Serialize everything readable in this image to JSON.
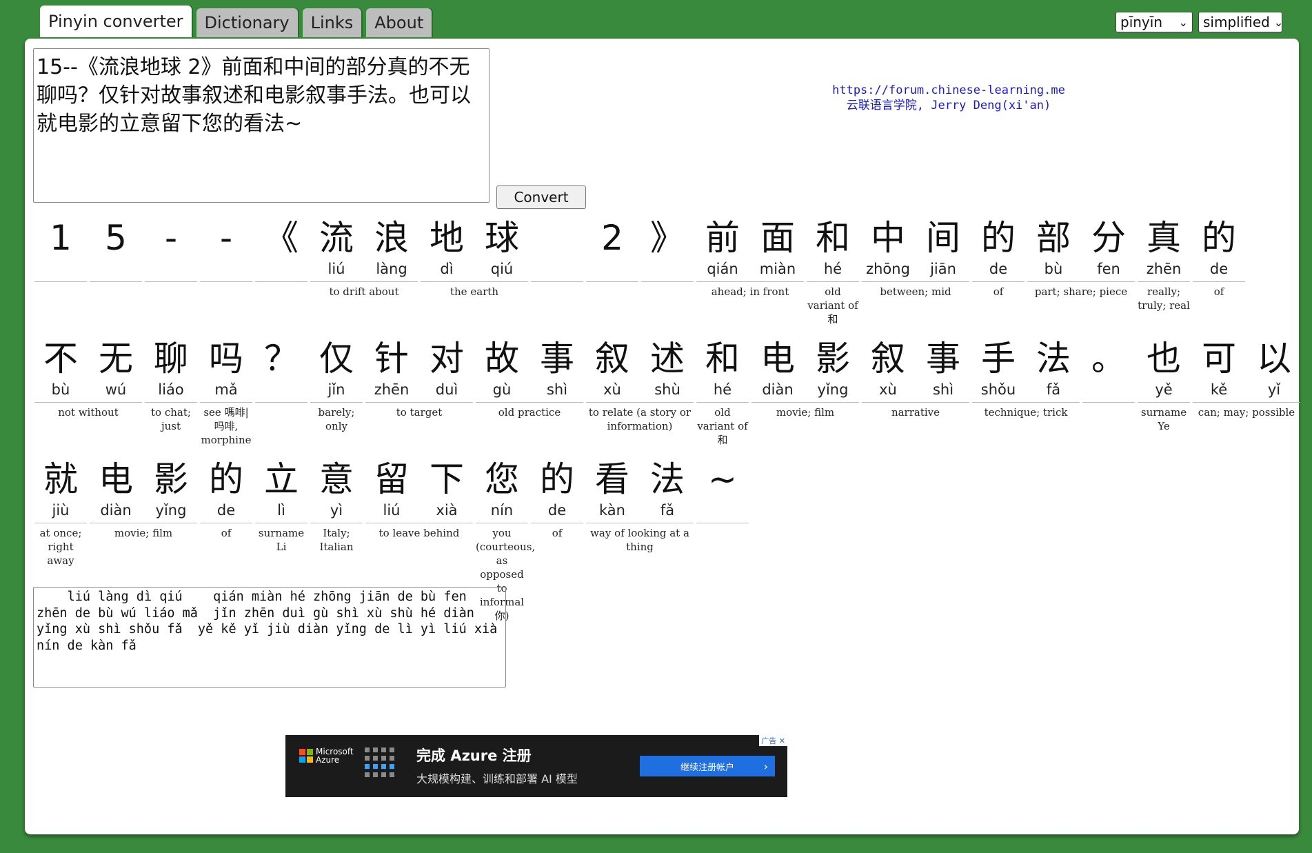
{
  "tabs": [
    "Pinyin converter",
    "Dictionary",
    "Links",
    "About"
  ],
  "selects": {
    "tone": "pīnyīn",
    "script": "simplified"
  },
  "input_text": "15--《流浪地球 2》前面和中间的部分真的不无聊吗？仅针对故事叙述和电影叙事手法。也可以就电影的立意留下您的看法~",
  "convert_label": "Convert",
  "attribution": {
    "url": "https://forum.chinese-learning.me",
    "credit": "云联语言学院, Jerry Deng(xi'an)"
  },
  "rows": [
    [
      {
        "chars": [
          {
            "h": "1",
            "p": ""
          }
        ],
        "gloss": ""
      },
      {
        "chars": [
          {
            "h": "5",
            "p": ""
          }
        ],
        "gloss": ""
      },
      {
        "chars": [
          {
            "h": "-",
            "p": ""
          }
        ],
        "gloss": ""
      },
      {
        "chars": [
          {
            "h": "-",
            "p": ""
          }
        ],
        "gloss": ""
      },
      {
        "chars": [
          {
            "h": "《",
            "p": ""
          }
        ],
        "gloss": ""
      },
      {
        "chars": [
          {
            "h": "流",
            "p": "liú"
          },
          {
            "h": "浪",
            "p": "làng"
          }
        ],
        "gloss": "to drift about"
      },
      {
        "chars": [
          {
            "h": "地",
            "p": "dì"
          },
          {
            "h": "球",
            "p": "qiú"
          }
        ],
        "gloss": "the earth"
      },
      {
        "chars": [
          {
            "h": "",
            "p": ""
          }
        ],
        "gloss": ""
      },
      {
        "chars": [
          {
            "h": "2",
            "p": ""
          }
        ],
        "gloss": ""
      },
      {
        "chars": [
          {
            "h": "》",
            "p": ""
          }
        ],
        "gloss": ""
      },
      {
        "chars": [
          {
            "h": "前",
            "p": "qián"
          },
          {
            "h": "面",
            "p": "miàn"
          }
        ],
        "gloss": "ahead; in front"
      },
      {
        "chars": [
          {
            "h": "和",
            "p": "hé"
          }
        ],
        "gloss": "old variant of 和"
      },
      {
        "chars": [
          {
            "h": "中",
            "p": "zhōng"
          },
          {
            "h": "间",
            "p": "jiān"
          }
        ],
        "gloss": "between; mid"
      },
      {
        "chars": [
          {
            "h": "的",
            "p": "de"
          }
        ],
        "gloss": "of"
      },
      {
        "chars": [
          {
            "h": "部",
            "p": "bù"
          },
          {
            "h": "分",
            "p": "fen"
          }
        ],
        "gloss": "part; share; piece"
      },
      {
        "chars": [
          {
            "h": "真",
            "p": "zhēn"
          }
        ],
        "gloss": "really; truly; real"
      },
      {
        "chars": [
          {
            "h": "的",
            "p": "de"
          }
        ],
        "gloss": "of"
      }
    ],
    [
      {
        "chars": [
          {
            "h": "不",
            "p": "bù"
          },
          {
            "h": "无",
            "p": "wú"
          }
        ],
        "gloss": "not without"
      },
      {
        "chars": [
          {
            "h": "聊",
            "p": "liáo"
          }
        ],
        "gloss": "to chat; just"
      },
      {
        "chars": [
          {
            "h": "吗",
            "p": "mǎ"
          }
        ],
        "gloss": "see 嗎啡|吗啡, morphine"
      },
      {
        "chars": [
          {
            "h": "？",
            "p": ""
          }
        ],
        "gloss": ""
      },
      {
        "chars": [
          {
            "h": "仅",
            "p": "jǐn"
          }
        ],
        "gloss": "barely; only"
      },
      {
        "chars": [
          {
            "h": "针",
            "p": "zhēn"
          },
          {
            "h": "对",
            "p": "duì"
          }
        ],
        "gloss": "to target"
      },
      {
        "chars": [
          {
            "h": "故",
            "p": "gù"
          },
          {
            "h": "事",
            "p": "shì"
          }
        ],
        "gloss": "old practice"
      },
      {
        "chars": [
          {
            "h": "叙",
            "p": "xù"
          },
          {
            "h": "述",
            "p": "shù"
          }
        ],
        "gloss": "to relate (a story or information)"
      },
      {
        "chars": [
          {
            "h": "和",
            "p": "hé"
          }
        ],
        "gloss": "old variant of 和"
      },
      {
        "chars": [
          {
            "h": "电",
            "p": "diàn"
          },
          {
            "h": "影",
            "p": "yǐng"
          }
        ],
        "gloss": "movie; film"
      },
      {
        "chars": [
          {
            "h": "叙",
            "p": "xù"
          },
          {
            "h": "事",
            "p": "shì"
          }
        ],
        "gloss": "narrative"
      },
      {
        "chars": [
          {
            "h": "手",
            "p": "shǒu"
          },
          {
            "h": "法",
            "p": "fǎ"
          }
        ],
        "gloss": "technique; trick"
      },
      {
        "chars": [
          {
            "h": "。",
            "p": ""
          }
        ],
        "gloss": ""
      },
      {
        "chars": [
          {
            "h": "也",
            "p": "yě"
          }
        ],
        "gloss": "surname Ye"
      },
      {
        "chars": [
          {
            "h": "可",
            "p": "kě"
          },
          {
            "h": "以",
            "p": "yǐ"
          }
        ],
        "gloss": "can; may; possible"
      }
    ],
    [
      {
        "chars": [
          {
            "h": "就",
            "p": "jiù"
          }
        ],
        "gloss": "at once; right away"
      },
      {
        "chars": [
          {
            "h": "电",
            "p": "diàn"
          },
          {
            "h": "影",
            "p": "yǐng"
          }
        ],
        "gloss": "movie; film"
      },
      {
        "chars": [
          {
            "h": "的",
            "p": "de"
          }
        ],
        "gloss": "of"
      },
      {
        "chars": [
          {
            "h": "立",
            "p": "lì"
          }
        ],
        "gloss": "surname Li"
      },
      {
        "chars": [
          {
            "h": "意",
            "p": "yì"
          }
        ],
        "gloss": "Italy; Italian"
      },
      {
        "chars": [
          {
            "h": "留",
            "p": "liú"
          },
          {
            "h": "下",
            "p": "xià"
          }
        ],
        "gloss": "to leave behind"
      },
      {
        "chars": [
          {
            "h": "您",
            "p": "nín"
          }
        ],
        "gloss": "you (courteous, as opposed to informal 你)"
      },
      {
        "chars": [
          {
            "h": "的",
            "p": "de"
          }
        ],
        "gloss": "of"
      },
      {
        "chars": [
          {
            "h": "看",
            "p": "kàn"
          },
          {
            "h": "法",
            "p": "fǎ"
          }
        ],
        "gloss": "way of looking at a thing"
      },
      {
        "chars": [
          {
            "h": "~",
            "p": ""
          }
        ],
        "gloss": ""
      }
    ]
  ],
  "output_text": "    liú làng dì qiú    qián miàn hé zhōng jiān de bù fen zhēn de bù wú liáo mǎ  jǐn zhēn duì gù shì xù shù hé diàn yǐng xù shì shǒu fǎ  yě kě yǐ jiù diàn yǐng de lì yì liú xià nín de kàn fǎ",
  "ad": {
    "brand": "Microsoft Azure",
    "headline": "完成 Azure 注册",
    "subline": "大规模构建、训练和部署 AI 模型",
    "cta": "继续注册帐户",
    "tag": "广告"
  }
}
